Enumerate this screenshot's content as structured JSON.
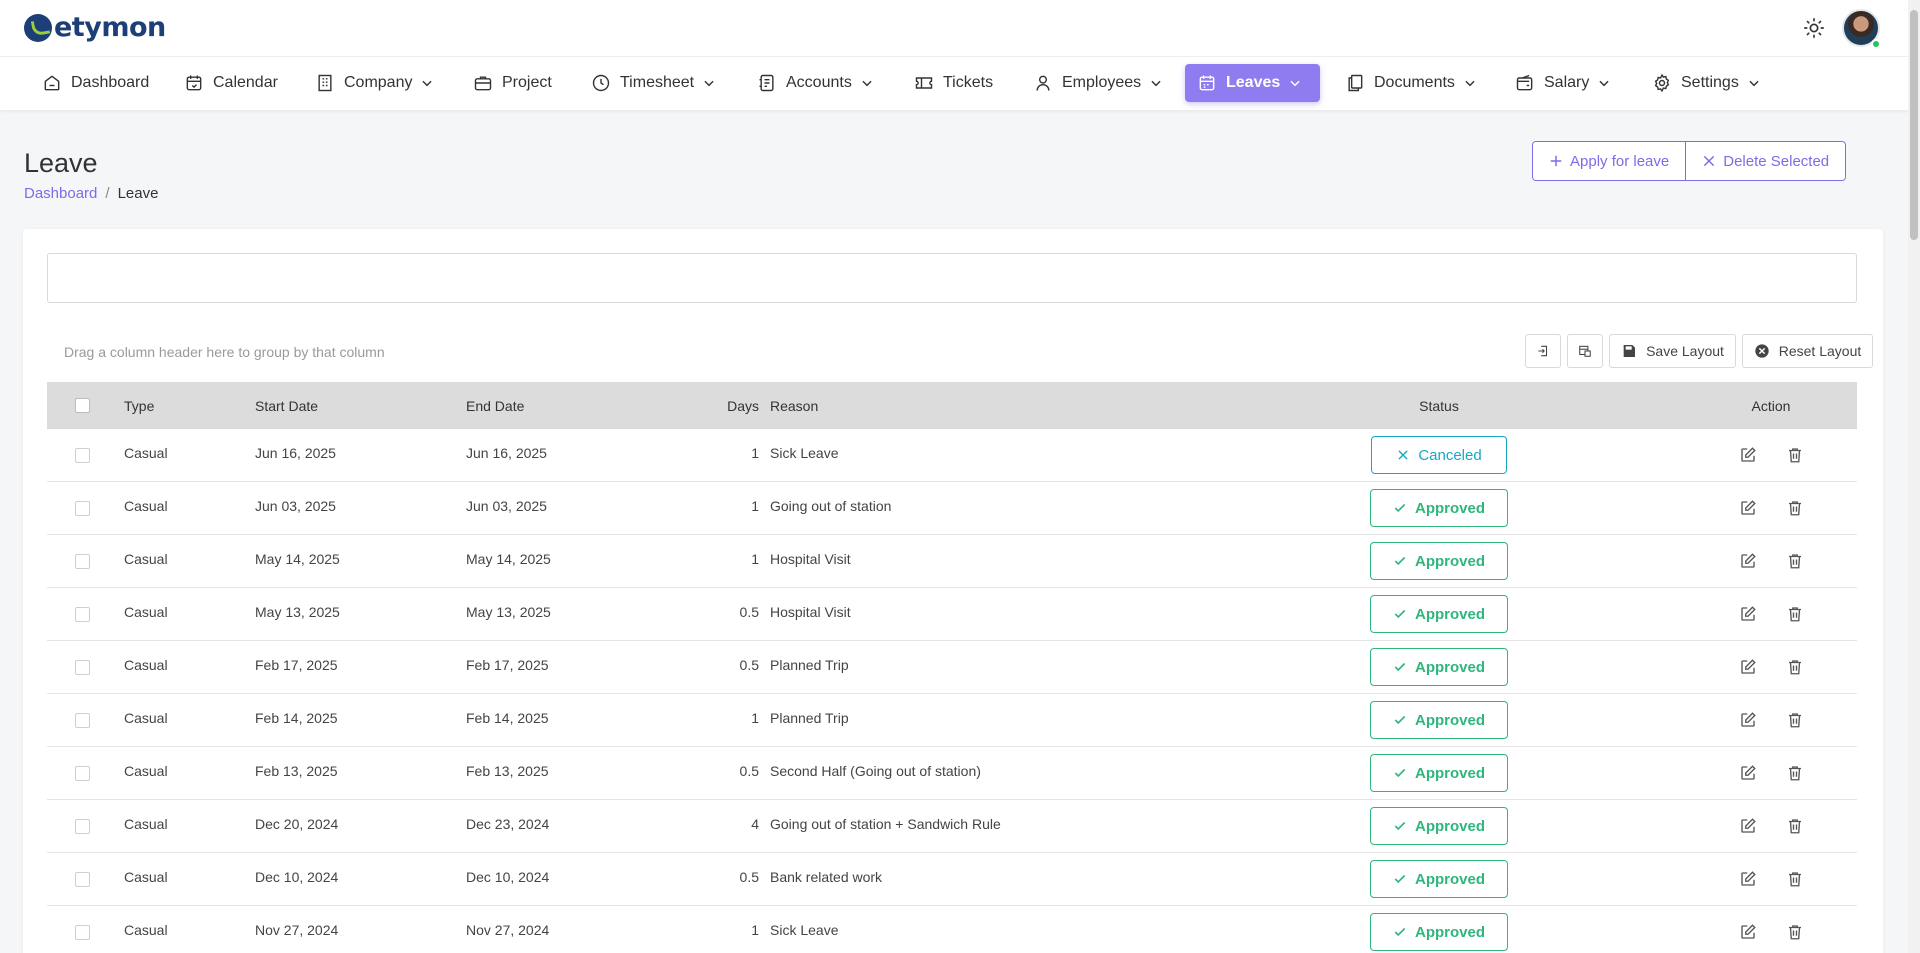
{
  "brand": {
    "name": "etymon"
  },
  "nav": {
    "items": [
      {
        "label": "Dashboard",
        "icon": "home-icon"
      },
      {
        "label": "Calendar",
        "icon": "calendar-check-icon"
      },
      {
        "label": "Company",
        "icon": "building-icon",
        "dropdown": true
      },
      {
        "label": "Project",
        "icon": "briefcase-icon"
      },
      {
        "label": "Timesheet",
        "icon": "clock-icon",
        "dropdown": true
      },
      {
        "label": "Accounts",
        "icon": "wallet-icon",
        "dropdown": true
      },
      {
        "label": "Tickets",
        "icon": "ticket-icon"
      },
      {
        "label": "Employees",
        "icon": "user-icon",
        "dropdown": true
      },
      {
        "label": "Leaves",
        "icon": "calendar-icon",
        "dropdown": true,
        "active": true
      },
      {
        "label": "Documents",
        "icon": "documents-icon",
        "dropdown": true
      },
      {
        "label": "Salary",
        "icon": "salary-icon",
        "dropdown": true
      },
      {
        "label": "Settings",
        "icon": "gear-icon",
        "dropdown": true
      }
    ]
  },
  "page": {
    "title": "Leave",
    "breadcrumb": {
      "root": "Dashboard",
      "separator": "/",
      "current": "Leave"
    },
    "actions": {
      "apply": "Apply for leave",
      "delete": "Delete Selected"
    }
  },
  "grid": {
    "group_hint": "Drag a column header here to group by that column",
    "toolbar": {
      "save_layout": "Save Layout",
      "reset_layout": "Reset Layout"
    },
    "columns": {
      "type": "Type",
      "start": "Start Date",
      "end": "End Date",
      "days": "Days",
      "reason": "Reason",
      "status": "Status",
      "action": "Action"
    },
    "rows": [
      {
        "type": "Casual",
        "start": "Jun 16, 2025",
        "end": "Jun 16, 2025",
        "days": "1",
        "reason": "Sick Leave",
        "status": "Canceled"
      },
      {
        "type": "Casual",
        "start": "Jun 03, 2025",
        "end": "Jun 03, 2025",
        "days": "1",
        "reason": "Going out of station",
        "status": "Approved"
      },
      {
        "type": "Casual",
        "start": "May 14, 2025",
        "end": "May 14, 2025",
        "days": "1",
        "reason": "Hospital Visit",
        "status": "Approved"
      },
      {
        "type": "Casual",
        "start": "May 13, 2025",
        "end": "May 13, 2025",
        "days": "0.5",
        "reason": "Hospital Visit",
        "status": "Approved"
      },
      {
        "type": "Casual",
        "start": "Feb 17, 2025",
        "end": "Feb 17, 2025",
        "days": "0.5",
        "reason": "Planned Trip",
        "status": "Approved"
      },
      {
        "type": "Casual",
        "start": "Feb 14, 2025",
        "end": "Feb 14, 2025",
        "days": "1",
        "reason": "Planned Trip",
        "status": "Approved"
      },
      {
        "type": "Casual",
        "start": "Feb 13, 2025",
        "end": "Feb 13, 2025",
        "days": "0.5",
        "reason": "Second Half (Going out of station)",
        "status": "Approved"
      },
      {
        "type": "Casual",
        "start": "Dec 20, 2024",
        "end": "Dec 23, 2024",
        "days": "4",
        "reason": "Going out of station + Sandwich Rule",
        "status": "Approved"
      },
      {
        "type": "Casual",
        "start": "Dec 10, 2024",
        "end": "Dec 10, 2024",
        "days": "0.5",
        "reason": "Bank related work",
        "status": "Approved"
      },
      {
        "type": "Casual",
        "start": "Nov 27, 2024",
        "end": "Nov 27, 2024",
        "days": "1",
        "reason": "Sick Leave",
        "status": "Approved"
      }
    ]
  },
  "colors": {
    "accent": "#8f7cf0",
    "approved": "#2fb67c",
    "canceled": "#18a8c4",
    "brand": "#1c3f78"
  }
}
